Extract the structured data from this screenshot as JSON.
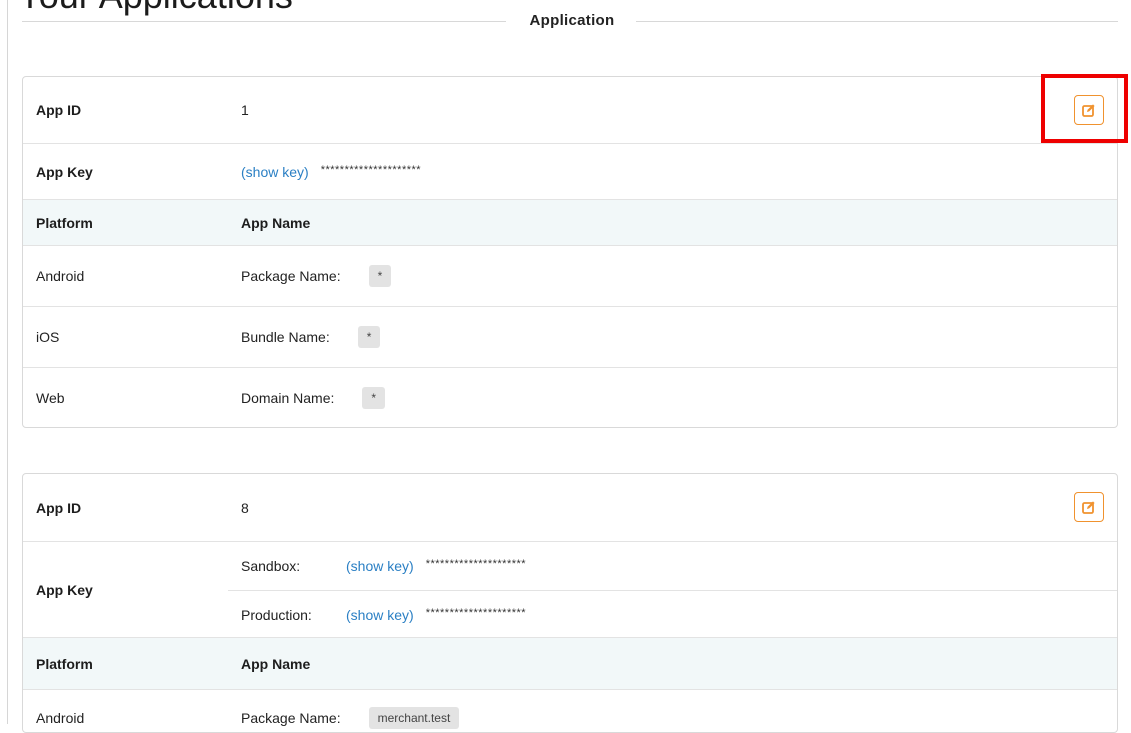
{
  "page_heading": "Your Applications",
  "section_title": "Application",
  "colors": {
    "accent": "#f0922e",
    "link": "#2a7fc4",
    "highlight": "#ee0000",
    "header_bg": "#f2f8f9"
  },
  "icons": {
    "edit": "edit-icon"
  },
  "apps": [
    {
      "app_id_label": "App ID",
      "app_id": "1",
      "app_key_label": "App Key",
      "key": {
        "show_label": "(show key)",
        "masked": "*********************"
      },
      "platform_header": "Platform",
      "app_name_header": "App Name",
      "platforms": [
        {
          "platform": "Android",
          "name_label": "Package Name:",
          "value": "*"
        },
        {
          "platform": "iOS",
          "name_label": "Bundle Name:",
          "value": "*"
        },
        {
          "platform": "Web",
          "name_label": "Domain Name:",
          "value": "*"
        }
      ]
    },
    {
      "app_id_label": "App ID",
      "app_id": "8",
      "app_key_label": "App Key",
      "keys": [
        {
          "env": "Sandbox:",
          "show_label": "(show key)",
          "masked": "*********************"
        },
        {
          "env": "Production:",
          "show_label": "(show key)",
          "masked": "*********************"
        }
      ],
      "platform_header": "Platform",
      "app_name_header": "App Name",
      "platforms": [
        {
          "platform": "Android",
          "name_label": "Package Name:",
          "value": "merchant.test"
        }
      ]
    }
  ]
}
